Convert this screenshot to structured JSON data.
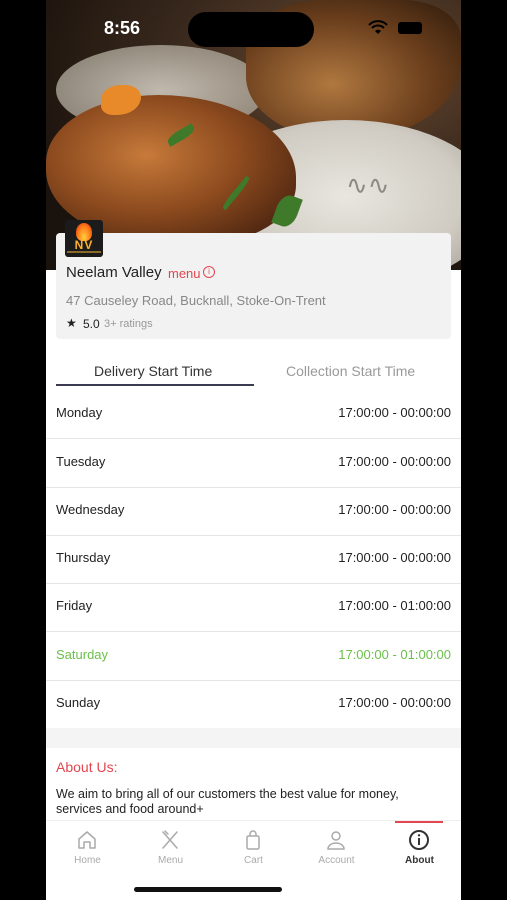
{
  "status_bar": {
    "time": "8:56"
  },
  "restaurant": {
    "name": "Neelam Valley",
    "menu_link": "menu",
    "address": "47 Causeley Road, Bucknall, Stoke-On-Trent",
    "rating": "5.0",
    "ratings_count": "3+ ratings",
    "logo_text": "NV"
  },
  "tabs": [
    {
      "label": "Delivery Start Time",
      "active": true
    },
    {
      "label": "Collection Start Time",
      "active": false
    }
  ],
  "schedule": [
    {
      "day": "Monday",
      "hours": "17:00:00 - 00:00:00"
    },
    {
      "day": "Tuesday",
      "hours": "17:00:00 - 00:00:00"
    },
    {
      "day": "Wednesday",
      "hours": "17:00:00 - 00:00:00"
    },
    {
      "day": "Thursday",
      "hours": "17:00:00 - 00:00:00"
    },
    {
      "day": "Friday",
      "hours": "17:00:00 - 01:00:00"
    },
    {
      "day": "Saturday",
      "hours": "17:00:00 - 01:00:00",
      "highlighted": true
    },
    {
      "day": "Sunday",
      "hours": "17:00:00 - 00:00:00"
    }
  ],
  "about": {
    "title": "About Us:",
    "text": "We aim to bring all of our customers the best value for money, services and food around+"
  },
  "nav": [
    {
      "label": "Home",
      "icon": "home-icon"
    },
    {
      "label": "Menu",
      "icon": "cutlery-icon"
    },
    {
      "label": "Cart",
      "icon": "shopping-bag-icon"
    },
    {
      "label": "Account",
      "icon": "user-icon"
    },
    {
      "label": "About",
      "icon": "info-icon",
      "active": true
    }
  ],
  "colors": {
    "accent": "#e2474f",
    "highlight": "#6cc04a",
    "tab_underline": "#3a3a50"
  }
}
